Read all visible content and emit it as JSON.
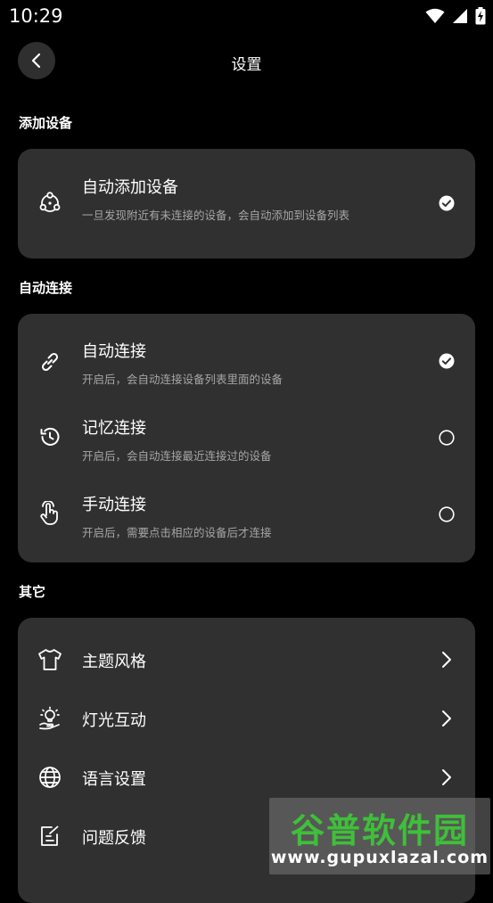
{
  "status_bar": {
    "time": "10:29"
  },
  "header": {
    "title": "设置"
  },
  "sections": {
    "add_device": {
      "title": "添加设备",
      "auto_add": {
        "title": "自动添加设备",
        "desc": "一旦发现附近有未连接的设备，会自动添加到设备列表",
        "checked": true
      }
    },
    "auto_connect": {
      "title": "自动连接",
      "options": [
        {
          "title": "自动连接",
          "desc": "开启后，会自动连接设备列表里面的设备",
          "selected": true
        },
        {
          "title": "记忆连接",
          "desc": "开启后，会自动连接最近连接过的设备",
          "selected": false
        },
        {
          "title": "手动连接",
          "desc": "开启后，需要点击相应的设备后才连接",
          "selected": false
        }
      ]
    },
    "other": {
      "title": "其它",
      "items": [
        {
          "label": "主题风格",
          "icon": "tshirt-icon"
        },
        {
          "label": "灯光互动",
          "icon": "light-bulb-icon"
        },
        {
          "label": "语言设置",
          "icon": "globe-icon"
        },
        {
          "label": "问题反馈",
          "icon": "feedback-edit-icon"
        }
      ]
    }
  },
  "watermark": {
    "brand": "谷普软件园",
    "url": "www.gupuxlazal.com"
  },
  "colors": {
    "background": "#000000",
    "card": "#303030",
    "watermark_green": "#3fbf3a"
  }
}
